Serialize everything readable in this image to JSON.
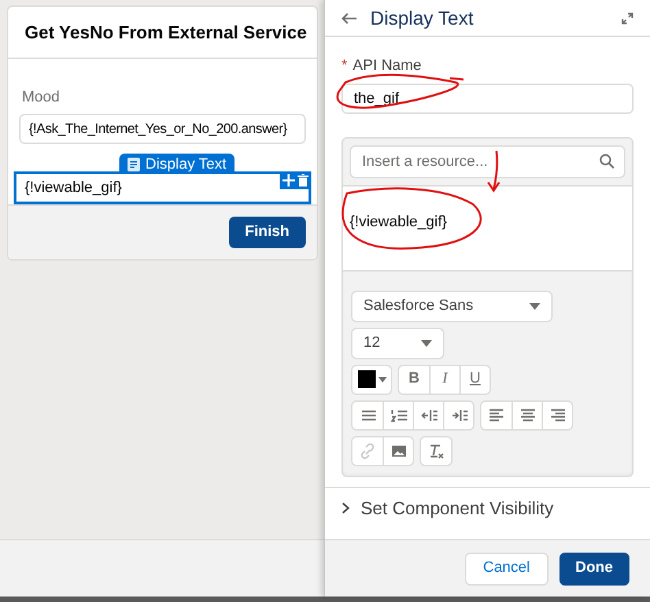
{
  "screen_card": {
    "title": "Get YesNo From External Service",
    "fields": [
      {
        "kind": "input",
        "label": "Mood",
        "value": "{!Ask_The_Internet_Yes_or_No_200.answer}"
      }
    ],
    "selected_component": {
      "badge": "Display Text",
      "text": "{!viewable_gif}",
      "selected": true
    },
    "buttons": [
      "Finish"
    ]
  },
  "properties_panel": {
    "title": "Display Text",
    "api_name": {
      "required_mark": "*",
      "label": "API Name",
      "required": true,
      "value": "the_gif"
    },
    "resource_search": {
      "placeholder": "Insert a resource..."
    },
    "editor_text": "{!viewable_gif}",
    "font": "Salesforce Sans",
    "size": "12",
    "toolbar": [
      [
        {
          "kind": "bold",
          "label": "B",
          "disabled": false
        },
        {
          "kind": "italic",
          "label": "I",
          "disabled": false
        },
        {
          "kind": "underline",
          "label": "U",
          "disabled": false
        }
      ],
      [
        {
          "kind": "bullets",
          "disabled": false
        },
        {
          "kind": "numbers",
          "disabled": false
        },
        {
          "kind": "outdent",
          "disabled": false
        },
        {
          "kind": "indent",
          "disabled": false
        }
      ],
      [
        {
          "kind": "align-left",
          "disabled": false
        },
        {
          "kind": "align-center",
          "disabled": false
        },
        {
          "kind": "align-right",
          "disabled": false
        }
      ],
      [
        {
          "kind": "link",
          "disabled": true
        },
        {
          "kind": "image",
          "disabled": false
        }
      ],
      [
        {
          "kind": "clear-format",
          "disabled": false
        }
      ]
    ],
    "sections": [
      {
        "label": "Set Component Visibility",
        "expanded": false
      }
    ],
    "buttons": [
      {
        "label": "Cancel",
        "kind": "neutral"
      },
      {
        "label": "Done",
        "kind": "brand"
      }
    ]
  }
}
